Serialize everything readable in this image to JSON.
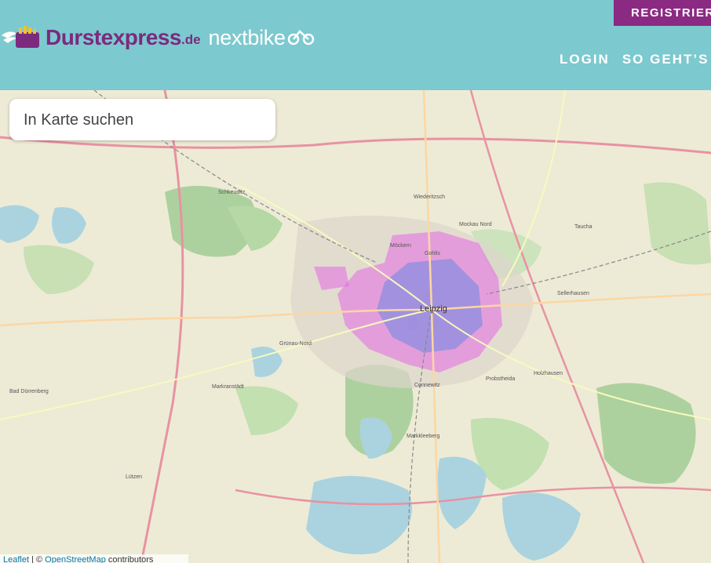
{
  "header": {
    "register_label": "REGISTRIERU",
    "brand_name": "Durstexpress",
    "brand_tld": ".de",
    "partner_name": "nextbike",
    "nav": [
      {
        "label": "LOGIN"
      },
      {
        "label": "SO GEHT’S"
      }
    ]
  },
  "search": {
    "placeholder": "In Karte suchen"
  },
  "map": {
    "city_label": "Leipzig",
    "labels": [
      {
        "text": "Schkeuditz"
      },
      {
        "text": "Wiederitzsch"
      },
      {
        "text": "Mockau Nord"
      },
      {
        "text": "Taucha"
      },
      {
        "text": "Markranstädt"
      },
      {
        "text": "Markkleeberg"
      },
      {
        "text": "Bad Dürrenberg"
      },
      {
        "text": "Grünau-Nord"
      },
      {
        "text": "Probstheida"
      },
      {
        "text": "Holzhausen"
      },
      {
        "text": "Lützen"
      },
      {
        "text": "Connewitz"
      },
      {
        "text": "Gohlis"
      },
      {
        "text": "Möckern"
      },
      {
        "text": "Sellerhausen"
      }
    ]
  },
  "attribution": {
    "leaflet": "Leaflet",
    "separator": " | © ",
    "osm": "OpenStreetMap",
    "suffix": " contributors"
  },
  "colors": {
    "header_bg": "#7cc9cf",
    "brand_purple": "#7b2a7e",
    "register_bg": "#8b2a82",
    "zone_pink": "#e66ae6",
    "zone_blue": "#6b87e0"
  }
}
